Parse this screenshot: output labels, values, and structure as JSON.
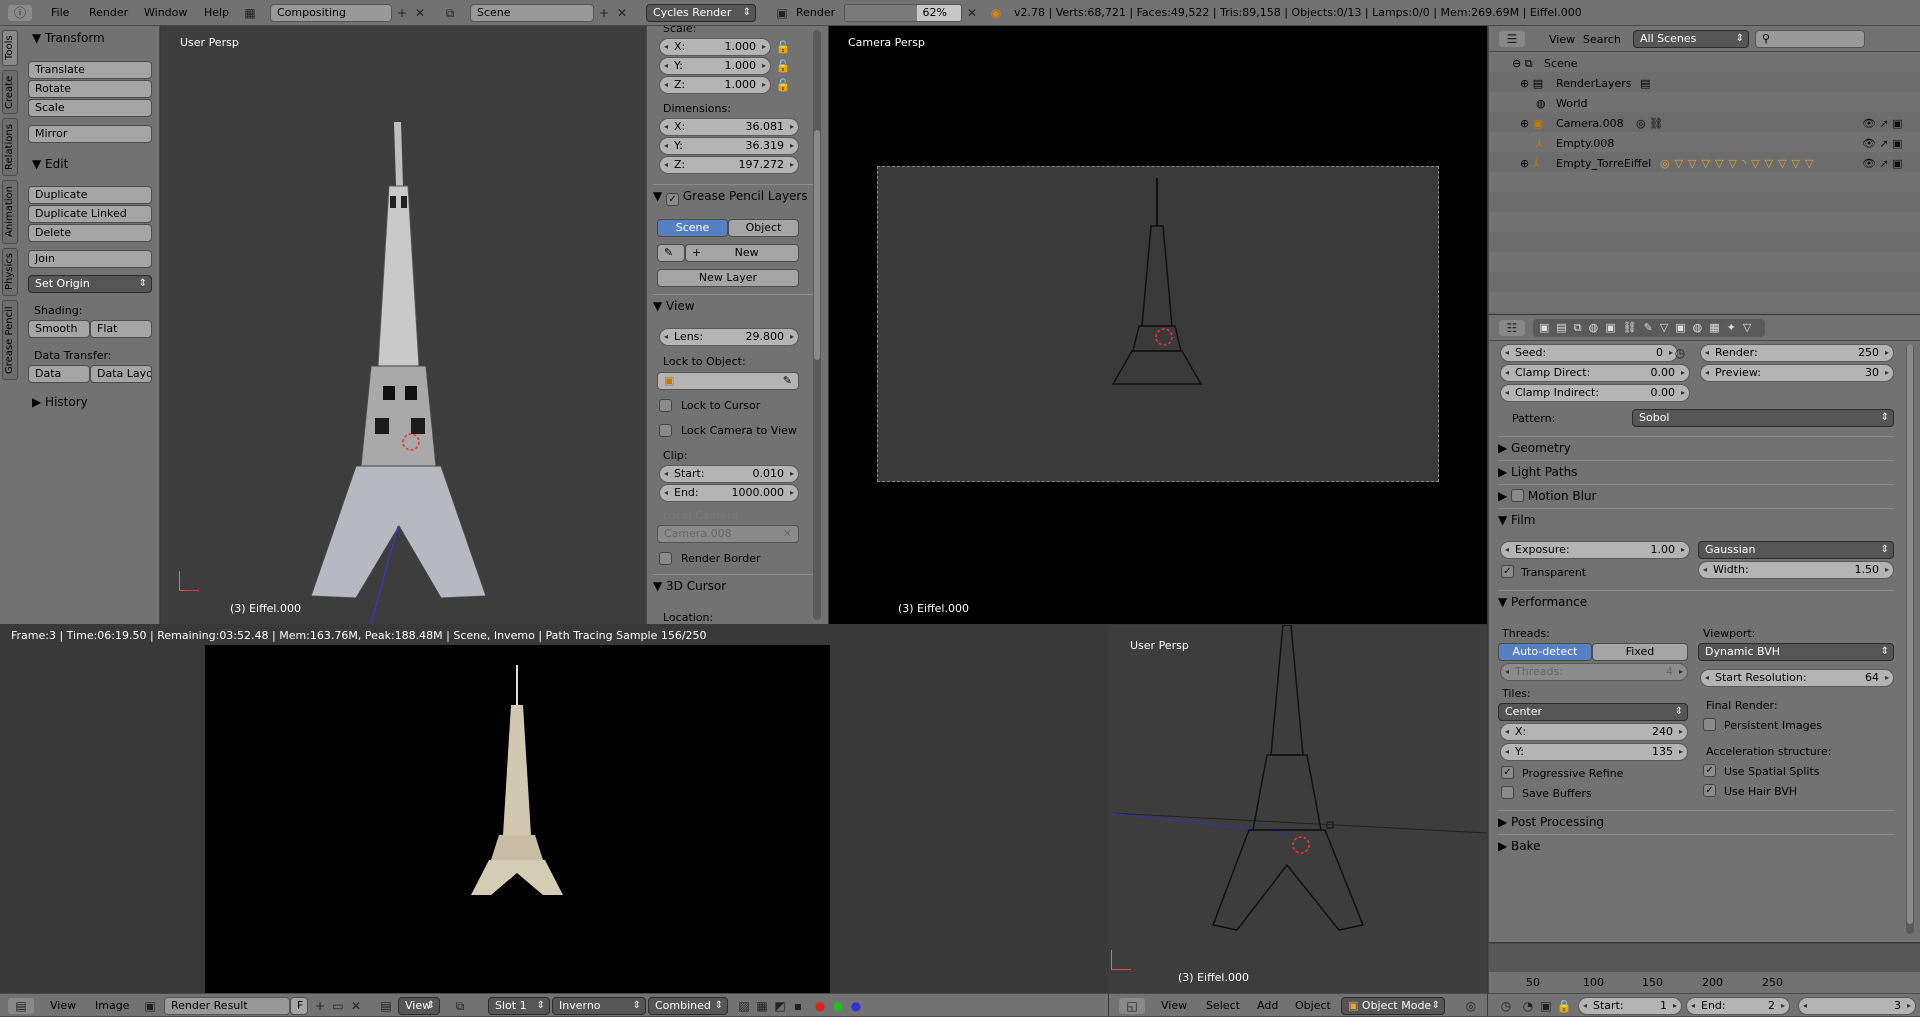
{
  "topbar": {
    "menus": [
      "File",
      "Render",
      "Window",
      "Help"
    ],
    "layout": "Compositing",
    "scene": "Scene",
    "engine": "Cycles Render",
    "render_label": "Render",
    "render_progress_text": "62%",
    "render_progress": 0.62,
    "stats": "v2.78 | Verts:68,721 | Faces:49,522 | Tris:89,158 | Objects:0/13 | Lamps:0/0 | Mem:269.69M | Eiffel.000"
  },
  "tool_tabs": [
    "Tools",
    "Create",
    "Relations",
    "Animation",
    "Physics",
    "Grease Pencil"
  ],
  "tools": {
    "transform_title": "Transform",
    "translate": "Translate",
    "rotate": "Rotate",
    "scale": "Scale",
    "mirror": "Mirror",
    "edit_title": "Edit",
    "duplicate": "Duplicate",
    "duplicate_linked": "Duplicate Linked",
    "delete": "Delete",
    "join": "Join",
    "set_origin": "Set Origin",
    "shading_label": "Shading:",
    "smooth": "Smooth",
    "flat": "Flat",
    "data_transfer_label": "Data Transfer:",
    "data": "Data",
    "data_layo": "Data Layo",
    "history_title": "History"
  },
  "viewport_left": {
    "label": "User Persp",
    "object": "(3) Eiffel.000"
  },
  "props_n": {
    "scale_label": "Scale:",
    "scale_x": "X:",
    "scale_x_val": "1.000",
    "scale_y": "Y:",
    "scale_y_val": "1.000",
    "scale_z": "Z:",
    "scale_z_val": "1.000",
    "dimensions_label": "Dimensions:",
    "dim_x": "X:",
    "dim_x_val": "36.081",
    "dim_y": "Y:",
    "dim_y_val": "36.319",
    "dim_z": "Z:",
    "dim_z_val": "197.272",
    "gp_layers_title": "Grease Pencil Layers",
    "gp_scene": "Scene",
    "gp_object": "Object",
    "gp_new": "New",
    "gp_new_layer": "New Layer",
    "view_title": "View",
    "lens_label": "Lens:",
    "lens_val": "29.800",
    "lock_to_object": "Lock to Object:",
    "lock_to_cursor": "Lock to Cursor",
    "lock_camera": "Lock Camera to View",
    "clip_label": "Clip:",
    "clip_start": "Start:",
    "clip_start_val": "0.010",
    "clip_end": "End:",
    "clip_end_val": "1000.000",
    "local_camera": "Local Camera:",
    "local_camera_val": "Camera.008",
    "render_border": "Render Border",
    "cursor_title": "3D Cursor",
    "location_label": "Location:"
  },
  "viewport_camera": {
    "label": "Camera Persp",
    "object": "(3) Eiffel.000"
  },
  "image_editor": {
    "status": "Frame:3 | Time:06:19.50 | Remaining:03:52.48 | Mem:163.76M, Peak:188.48M | Scene, Invemo | Path Tracing Sample 156/250",
    "menus": [
      "View",
      "Image"
    ],
    "image_name": "Render Result",
    "f_label": "F",
    "view_label": "View",
    "slot": "Slot 1",
    "layer": "Inverno",
    "pass": "Combined"
  },
  "viewport_bottom": {
    "label": "User Persp",
    "object": "(3) Eiffel.000",
    "menus": [
      "View",
      "Select",
      "Add",
      "Object"
    ],
    "mode": "Object Mode"
  },
  "outliner": {
    "view": "View",
    "search": "Search",
    "filter": "All Scenes",
    "rows": [
      "Scene",
      "RenderLayers",
      "World",
      "Camera.008",
      "Empty.008",
      "Empty_TorreEiffel"
    ]
  },
  "render_props": {
    "seed_label": "Seed:",
    "seed_val": "0",
    "render_label": "Render:",
    "render_val": "250",
    "clamp_direct_label": "Clamp Direct:",
    "clamp_direct_val": "0.00",
    "preview_label": "Preview:",
    "preview_val": "30",
    "clamp_indirect_label": "Clamp Indirect:",
    "clamp_indirect_val": "0.00",
    "pattern_label": "Pattern:",
    "pattern_val": "Sobol",
    "geometry": "Geometry",
    "light_paths": "Light Paths",
    "motion_blur": "Motion Blur",
    "film": "Film",
    "exposure_label": "Exposure:",
    "exposure_val": "1.00",
    "filter_val": "Gaussian",
    "transparent": "Transparent",
    "width_label": "Width:",
    "width_val": "1.50",
    "performance": "Performance",
    "threads_label": "Threads:",
    "auto_detect": "Auto-detect",
    "fixed": "Fixed",
    "threads_field": "Threads:",
    "threads_val": "4",
    "viewport_label": "Viewport:",
    "viewport_val": "Dynamic BVH",
    "start_res_label": "Start Resolution:",
    "start_res_val": "64",
    "tiles_label": "Tiles:",
    "tiles_order": "Center",
    "final_render_label": "Final Render:",
    "persistent_images": "Persistent Images",
    "tile_x_label": "X:",
    "tile_x_val": "240",
    "tile_y_label": "Y:",
    "tile_y_val": "135",
    "accel_label": "Acceleration structure:",
    "progressive_refine": "Progressive Refine",
    "use_spatial_splits": "Use Spatial Splits",
    "save_buffers": "Save Buffers",
    "use_hair_bvh": "Use Hair BVH",
    "post_processing": "Post Processing",
    "bake": "Bake"
  },
  "timeline": {
    "ticks": [
      "50",
      "100",
      "150",
      "200",
      "250"
    ],
    "start_label": "Start:",
    "start_val": "1",
    "end_label": "End:",
    "end_val": "2",
    "current": "3"
  }
}
